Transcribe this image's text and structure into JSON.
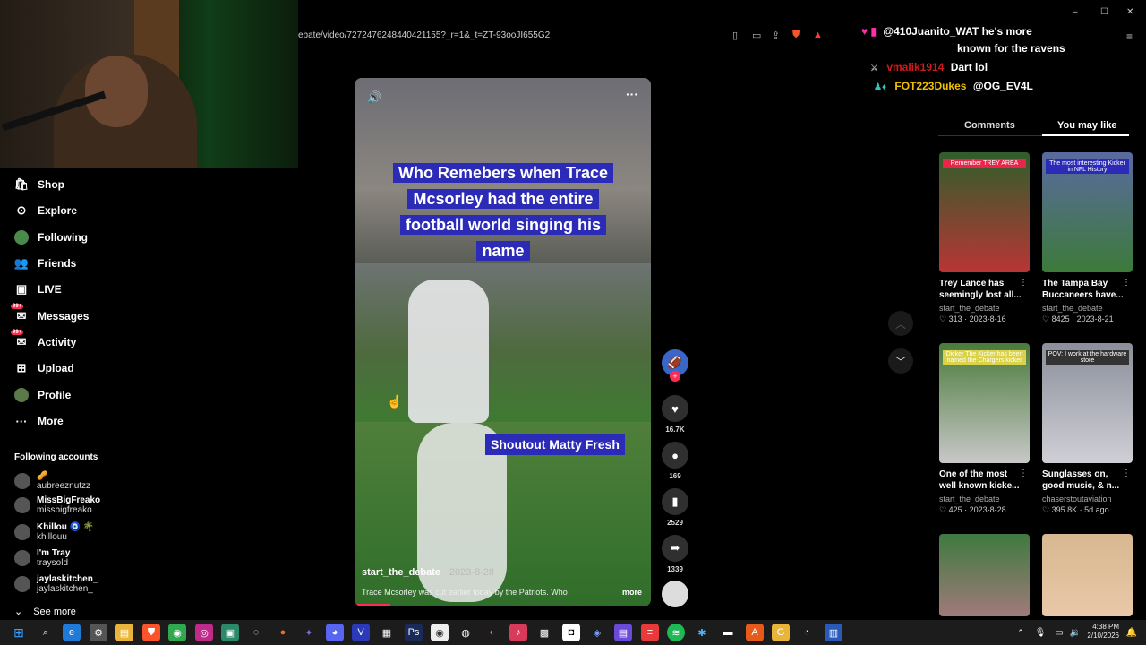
{
  "browser": {
    "url": "ebate/video/7272476248440421155?_r=1&_t=ZT-93ooJI655G2"
  },
  "sidebar": {
    "items": [
      {
        "label": "Shop",
        "icon": "shop-bag-icon",
        "badge": ""
      },
      {
        "label": "Explore",
        "icon": "compass-icon",
        "badge": ""
      },
      {
        "label": "Following",
        "icon": "following-avatar-icon",
        "badge": ""
      },
      {
        "label": "Friends",
        "icon": "friends-icon",
        "badge": ""
      },
      {
        "label": "LIVE",
        "icon": "live-icon",
        "badge": ""
      },
      {
        "label": "Messages",
        "icon": "messages-icon",
        "badge": "99+"
      },
      {
        "label": "Activity",
        "icon": "activity-icon",
        "badge": "99+"
      },
      {
        "label": "Upload",
        "icon": "upload-icon",
        "badge": ""
      },
      {
        "label": "Profile",
        "icon": "profile-avatar-icon",
        "badge": ""
      },
      {
        "label": "More",
        "icon": "more-dots-icon",
        "badge": ""
      }
    ],
    "following_header": "Following accounts",
    "accounts": [
      {
        "name": "🥜",
        "handle": "aubreeznutzz"
      },
      {
        "name": "MissBigFreako",
        "handle": "missbigfreako"
      },
      {
        "name": "Khillou 🧿 🌴",
        "handle": "khillouu"
      },
      {
        "name": "I'm Tray",
        "handle": "traysold"
      },
      {
        "name": "jaylaskitchen_",
        "handle": "jaylaskitchen_"
      }
    ],
    "see_more": "See more"
  },
  "video": {
    "caption_top": "Who Remebers when Trace Mcsorley had the entire football world singing his name",
    "caption_bottom": "Shoutout Matty Fresh",
    "author": "start_the_debate",
    "date": " · 2023-8-28",
    "description": "Trace Mcsorley was cut earlier today by the Patriots. Who",
    "more": "more",
    "progress": 0.12
  },
  "actions": {
    "likes": "16.7K",
    "comments": "169",
    "saves": "2529",
    "shares": "1339"
  },
  "chat": [
    {
      "user": "@410Juanito_WAT",
      "text": "he's more",
      "text2": "known for the ravens",
      "user_color": "#ff2fa8"
    },
    {
      "user": "vmalik1914",
      "text": "Dart lol",
      "user_color": "#d21a1a"
    },
    {
      "user": "FOT223Dukes",
      "text": "@OG_EV4L",
      "user_color": "#f0c000"
    }
  ],
  "panel": {
    "tabs": [
      "Comments",
      "You may like"
    ],
    "active_tab": "You may like",
    "cards": [
      {
        "title": "Trey Lance has seemingly lost all...",
        "author": "start_the_debate",
        "meta": "♡ 313 · 2023-8-16",
        "thumb_label": "Remember TREY AREA",
        "label_bg": "#e8264a",
        "bg1": "#2f5e2a",
        "bg2": "#b83535"
      },
      {
        "title": "The Tampa Bay Buccaneers have...",
        "author": "start_the_debate",
        "meta": "♡ 8425 · 2023-8-21",
        "thumb_label": "The most interesting Kicker in NFL History",
        "label_bg": "#2b2bb8",
        "bg1": "#5a6aa0",
        "bg2": "#3c7a3a"
      },
      {
        "title": "One of the most well known kicke...",
        "author": "start_the_debate",
        "meta": "♡ 425 · 2023-8-28",
        "thumb_label": "Dicker The Kicker has been named the Chargers kicker",
        "label_bg": "#d9d24a",
        "bg1": "#4a7a3a",
        "bg2": "#c8c8c8"
      },
      {
        "title": "Sunglasses on, good music, & n...",
        "author": "chaserstoutaviation",
        "meta": "♡ 395.8K · 5d ago",
        "thumb_label": "POV: I work at the hardware store",
        "label_bg": "#333333",
        "bg1": "#8a8f9a",
        "bg2": "#d0cfd6"
      },
      {
        "title": "",
        "author": "",
        "meta": "",
        "thumb_label": "",
        "label_bg": "#000000",
        "bg1": "#3f7a3f",
        "bg2": "#a07a7a"
      },
      {
        "title": "",
        "author": "",
        "meta": "",
        "thumb_label": "",
        "label_bg": "#000000",
        "bg1": "#d8b890",
        "bg2": "#e8c8a8"
      }
    ]
  },
  "taskbar": {
    "time": "4:38 PM",
    "date": "2/10/2026"
  },
  "colors": {
    "accent": "#fe2c55",
    "caption_bg": "#2b2bb8"
  }
}
